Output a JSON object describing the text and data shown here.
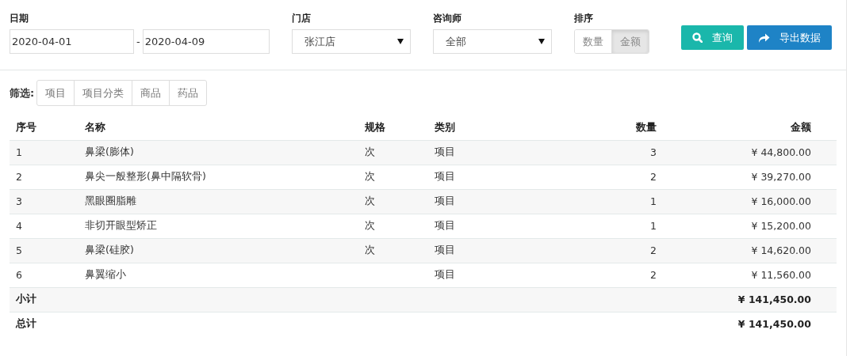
{
  "filters": {
    "date": {
      "label": "日期",
      "from": "2020-04-01",
      "separator": "-",
      "to": "2020-04-09"
    },
    "store": {
      "label": "门店",
      "value": "张江店"
    },
    "consultant": {
      "label": "咨询师",
      "value": "全部"
    },
    "sort": {
      "label": "排序",
      "options": [
        {
          "label": "数量",
          "selected": false
        },
        {
          "label": "金额",
          "selected": true
        }
      ]
    }
  },
  "buttons": [
    {
      "kind": "search",
      "label": "查询"
    },
    {
      "kind": "export",
      "label": "导出数据"
    }
  ],
  "screen": {
    "label": "筛选:",
    "options": [
      {
        "label": "项目",
        "selected": false
      },
      {
        "label": "项目分类",
        "selected": false
      },
      {
        "label": "商品",
        "selected": false
      },
      {
        "label": "药品",
        "selected": false
      }
    ]
  },
  "table": {
    "columns": [
      "序号",
      "名称",
      "规格",
      "类别",
      "数量",
      "金额"
    ],
    "rows": [
      [
        "1",
        "鼻梁(膨体)",
        "次",
        "项目",
        "3",
        "¥ 44,800.00"
      ],
      [
        "2",
        "鼻尖一般整形(鼻中隔软骨)",
        "次",
        "项目",
        "2",
        "¥ 39,270.00"
      ],
      [
        "3",
        "黑眼圈脂雕",
        "次",
        "项目",
        "1",
        "¥ 16,000.00"
      ],
      [
        "4",
        "非切开眼型矫正",
        "次",
        "项目",
        "1",
        "¥ 15,200.00"
      ],
      [
        "5",
        "鼻梁(硅胶)",
        "次",
        "项目",
        "2",
        "¥ 14,620.00"
      ],
      [
        "6",
        "鼻翼缩小",
        "",
        "项目",
        "2",
        "¥ 11,560.00"
      ]
    ],
    "summary": [
      {
        "label": "小计",
        "amount": "¥ 141,450.00"
      },
      {
        "label": "总计",
        "amount": "¥ 141,450.00"
      }
    ]
  }
}
